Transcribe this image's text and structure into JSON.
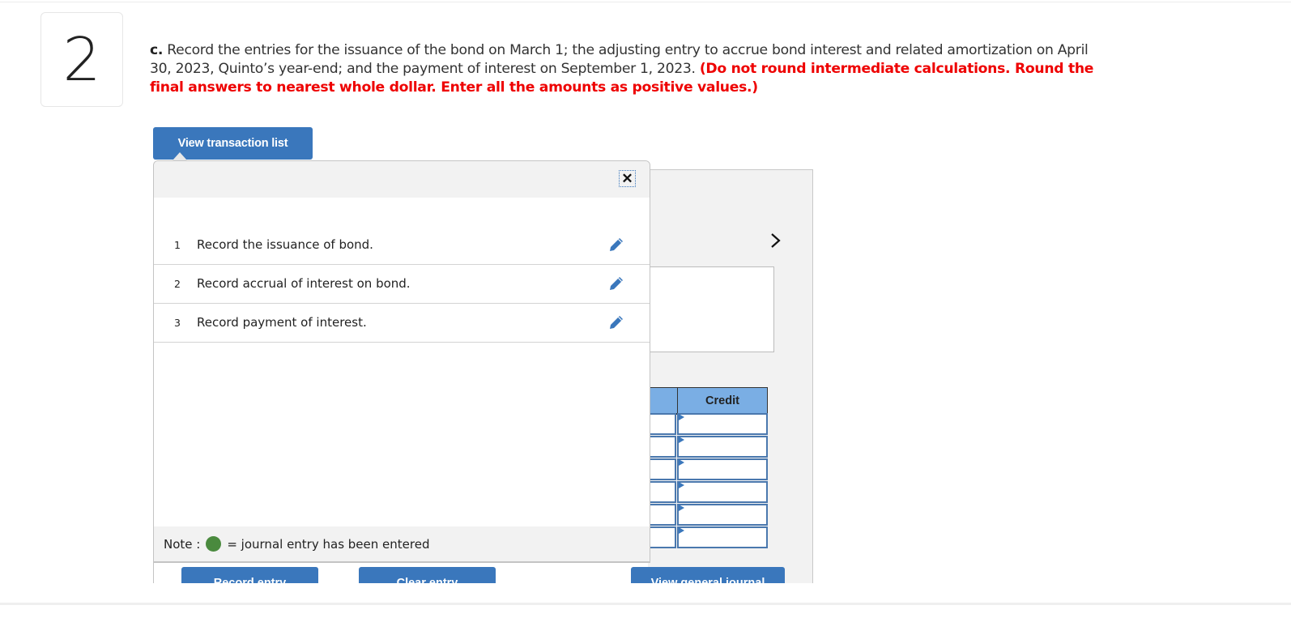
{
  "question": {
    "number": "2",
    "part_label": "c.",
    "text": "Record the entries for the issuance of the bond on March 1; the adjusting entry to accrue bond interest and related amortization on April 30, 2023, Quinto’s year-end; and the payment of interest on September 1, 2023.",
    "instruction": "(Do not round intermediate calculations. Round the final answers to nearest whole dollar. Enter all the amounts as positive values.)"
  },
  "buttons": {
    "view_transaction_list": "View transaction list",
    "record_entry": "Record entry",
    "clear_entry": "Clear entry",
    "view_general_journal": "View general journal"
  },
  "popup": {
    "close_icon": "close-icon",
    "transactions": [
      {
        "num": "1",
        "label": "Record the issuance of bond.",
        "icon": "pencil-icon"
      },
      {
        "num": "2",
        "label": "Record accrual of interest on bond.",
        "icon": "pencil-icon"
      },
      {
        "num": "3",
        "label": "Record payment of interest.",
        "icon": "pencil-icon"
      }
    ],
    "note": {
      "label": "Note :",
      "text": "= journal entry has been entered",
      "dot_color": "#4a8a3e"
    }
  },
  "journal": {
    "next_icon": "chevron-right-icon",
    "columns": {
      "debit": "",
      "credit": "Credit"
    },
    "rows": [
      {
        "debit": "",
        "credit": ""
      },
      {
        "debit": "",
        "credit": ""
      },
      {
        "debit": "",
        "credit": ""
      },
      {
        "debit": "",
        "credit": ""
      },
      {
        "debit": "",
        "credit": ""
      },
      {
        "debit": "",
        "credit": ""
      }
    ]
  },
  "colors": {
    "accent": "#3a77bc",
    "warning": "#ee0000",
    "table_header": "#7aaee4"
  }
}
